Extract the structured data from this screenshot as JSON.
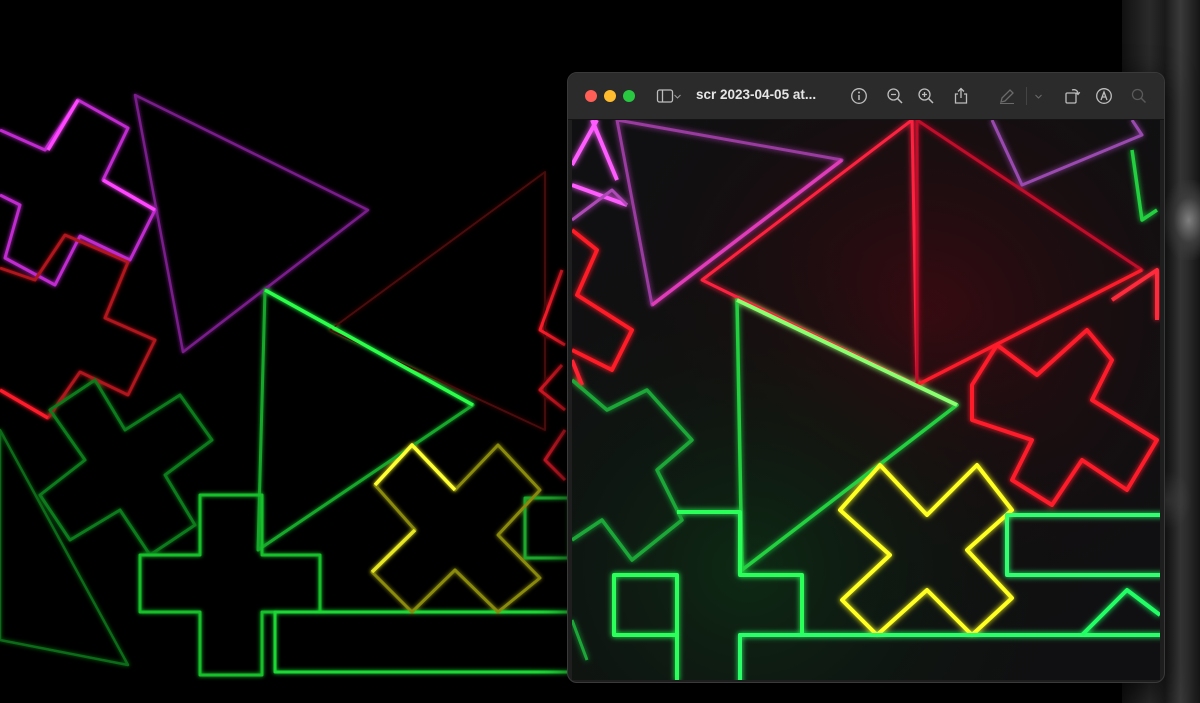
{
  "window": {
    "title": "scr 2023-04-05 at...",
    "traffic_lights": {
      "close_color": "#ff5f57",
      "minimize_color": "#febc2e",
      "zoom_color": "#28c840"
    }
  },
  "toolbar": {
    "icons": [
      "sidebar-toggle-icon",
      "chevron-down-icon",
      "info-icon",
      "zoom-out-icon",
      "zoom-in-icon",
      "share-icon",
      "markup-pen-icon",
      "chevron-down-icon",
      "rotate-icon",
      "annotate-icon",
      "search-icon"
    ]
  },
  "colors": {
    "magenta": "#ff3cff",
    "purple": "#9b2ab0",
    "red": "#ff1a2a",
    "green": "#22ff44",
    "yellow": "#ffff22",
    "window_bg": "#1e1e1e",
    "titlebar_bg": "#2b2b2c"
  }
}
